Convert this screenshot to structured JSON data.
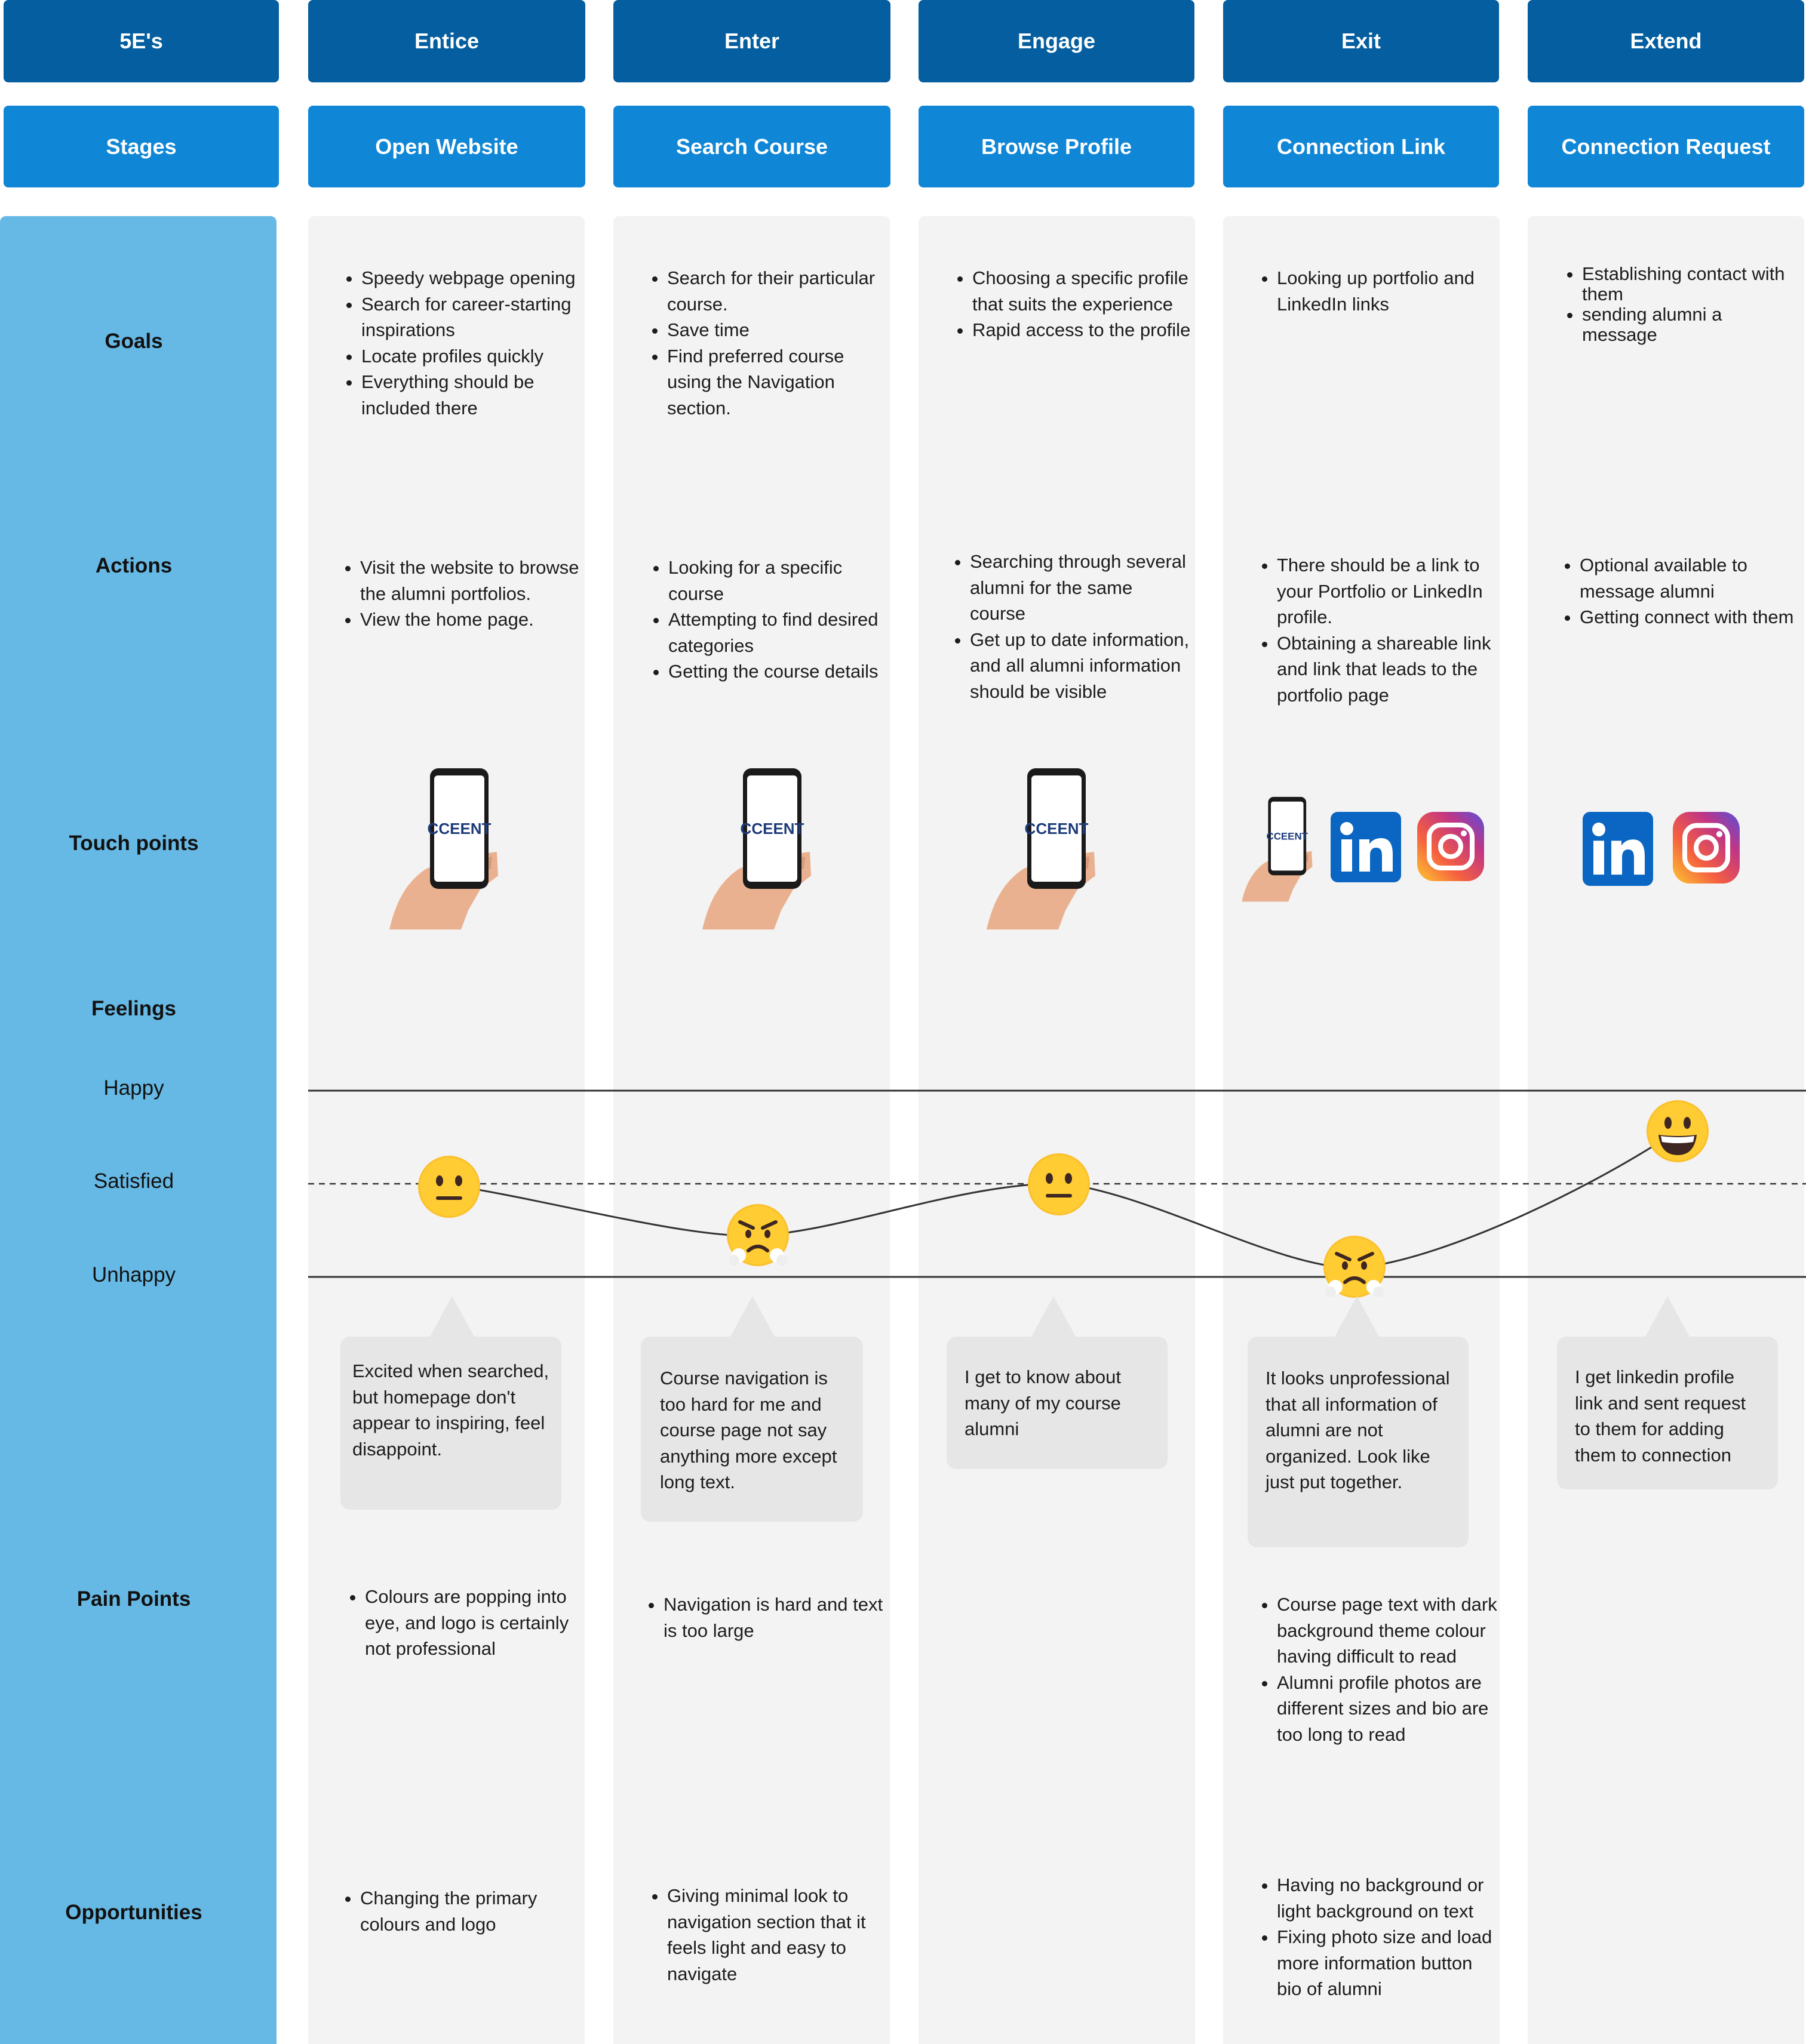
{
  "phases": {
    "label": "5E's",
    "items": [
      "Entice",
      "Enter",
      "Engage",
      "Exit",
      "Extend"
    ]
  },
  "stages": {
    "label": "Stages",
    "items": [
      "Open Website",
      "Search Course",
      "Browse Profile",
      "Connection Link",
      "Connection Request"
    ]
  },
  "rows": {
    "goals": "Goals",
    "actions": "Actions",
    "touch_points": "Touch points",
    "feelings": "Feelings",
    "pain_points": "Pain Points",
    "opportunities": "Opportunities"
  },
  "feeling_levels": [
    "Happy",
    "Satisfied",
    "Unhappy"
  ],
  "goals": [
    [
      "Speedy webpage opening",
      "Search for career-starting inspirations",
      "Locate profiles quickly",
      "Everything should be included there"
    ],
    [
      "Search for their particular course.",
      "Save time",
      "Find preferred course using the Navigation section."
    ],
    [
      "Choosing a specific profile that suits the experience",
      "Rapid access to the profile"
    ],
    [
      "Looking up portfolio and LinkedIn links"
    ],
    [
      "Establishing contact with them",
      "sending alumni a message"
    ]
  ],
  "actions": [
    [
      "Visit the website to browse the alumni portfolios.",
      "View the home page."
    ],
    [
      "Looking for a specific course",
      "Attempting to find desired categories",
      "Getting the course details"
    ],
    [
      "Searching through several alumni for the same course",
      "Get up to date information, and all alumni information should be visible"
    ],
    [
      "There should be a link to your Portfolio or LinkedIn profile.",
      "Obtaining a shareable link and link that leads to the portfolio page"
    ],
    [
      "Optional available to message alumni",
      "Getting connect with them"
    ]
  ],
  "touch_points": [
    [
      "phone-in-hand"
    ],
    [
      "phone-in-hand"
    ],
    [
      "phone-in-hand"
    ],
    [
      "phone-in-hand",
      "linkedin",
      "instagram"
    ],
    [
      "linkedin",
      "instagram"
    ]
  ],
  "phone_logo": "CCEENT",
  "feelings": [
    {
      "level": "Satisfied",
      "emoji": "neutral-face"
    },
    {
      "level": "Unhappy",
      "emoji": "angry-face"
    },
    {
      "level": "Satisfied",
      "emoji": "neutral-face"
    },
    {
      "level": "Unhappy",
      "emoji": "angry-face"
    },
    {
      "level": "Happy",
      "emoji": "grinning-face"
    }
  ],
  "quotes": [
    "Excited when searched, but homepage don't appear to inspiring, feel disappoint.",
    "Course navigation is too hard for me and course page not say anything more except long text.",
    "I get to know about many of my course alumni",
    "It looks unprofessional that all information of alumni are not organized. Look like just put together.",
    "I get linkedin profile link and sent request to them for adding them to connection"
  ],
  "pain_points": [
    [
      "Colours are popping into eye, and logo is certainly not professional"
    ],
    [
      "Navigation is hard and text is too large"
    ],
    [],
    [
      "Course page text with dark background theme colour having difficult to read",
      "Alumni profile photos are different sizes and bio are too long to read"
    ],
    []
  ],
  "opportunities": [
    [
      "Changing the primary colours and logo"
    ],
    [
      "Giving minimal look to navigation section that it feels light and easy to navigate"
    ],
    [],
    [
      "Having no background or light background on text",
      "Fixing photo size and load more information button bio of alumni"
    ],
    []
  ],
  "colors": {
    "phase_header": "#045e9f",
    "stage_header": "#0f86d6",
    "sidebar": "#67b9e5",
    "column": "#f3f3f3",
    "bubble": "#e6e6e6",
    "linkedin": "#0a66c2"
  }
}
